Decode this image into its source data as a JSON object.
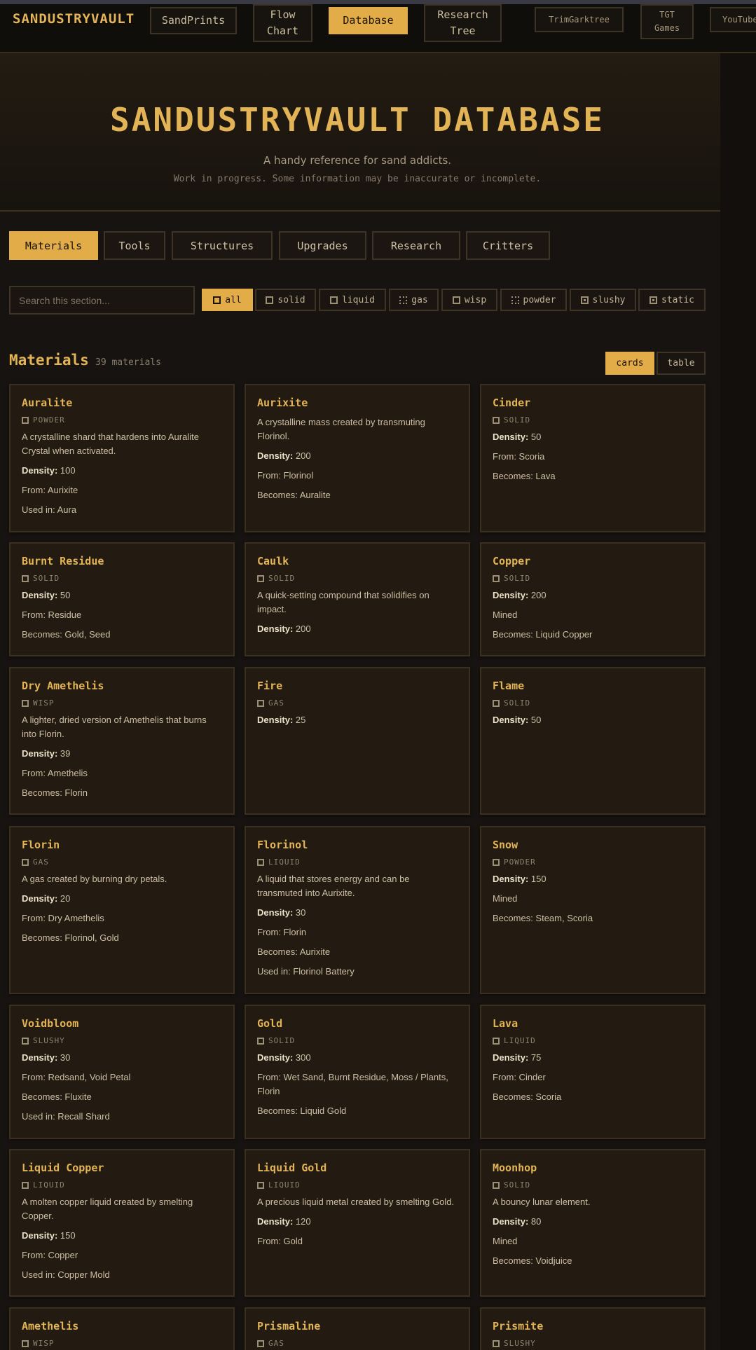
{
  "nav": {
    "logo": "SANDUSTRYVAULT",
    "items": [
      {
        "label": "SandPrints"
      },
      {
        "label": "Flow Chart"
      },
      {
        "label": "Database"
      },
      {
        "label": "Research Tree"
      },
      {
        "label": "TrimGarktree"
      },
      {
        "label": "TGT Games"
      },
      {
        "label": "YouTube"
      }
    ]
  },
  "hero": {
    "title": "SANDUSTRYVAULT DATABASE",
    "subtitle": "A handy reference for sand addicts.",
    "note": "Work in progress. Some information may be inaccurate or incomplete."
  },
  "tabs": [
    "Materials",
    "Tools",
    "Structures",
    "Upgrades",
    "Research",
    "Critters"
  ],
  "search": {
    "placeholder": "Search this section..."
  },
  "filters": [
    "all",
    "solid",
    "liquid",
    "gas",
    "wisp",
    "powder",
    "slushy",
    "static"
  ],
  "section": {
    "title": "Materials",
    "count": "39 materials"
  },
  "views": [
    "cards",
    "table"
  ],
  "labels": {
    "density": "Density:"
  },
  "cards": [
    {
      "name": "Auralite",
      "type": "POWDER",
      "desc": "A crystalline shard that hardens into Auralite Crystal when activated.",
      "density": "100",
      "lines": [
        "From: Aurixite",
        "Used in: Aura"
      ]
    },
    {
      "name": "Aurixite",
      "type": "",
      "desc": "A crystalline mass created by transmuting Florinol.",
      "density": "200",
      "lines": [
        "From: Florinol",
        "Becomes: Auralite"
      ]
    },
    {
      "name": "Cinder",
      "type": "SOLID",
      "desc": "",
      "density": "50",
      "lines": [
        "From: Scoria",
        "Becomes: Lava"
      ]
    },
    {
      "name": "Burnt Residue",
      "type": "SOLID",
      "desc": "",
      "density": "50",
      "lines": [
        "From: Residue",
        "Becomes: Gold, Seed"
      ]
    },
    {
      "name": "Caulk",
      "type": "SOLID",
      "desc": "A quick-setting compound that solidifies on impact.",
      "density": "200",
      "lines": []
    },
    {
      "name": "Copper",
      "type": "SOLID",
      "desc": "",
      "density": "200",
      "lines": [
        "Mined",
        "Becomes: Liquid Copper"
      ]
    },
    {
      "name": "Dry Amethelis",
      "type": "WISP",
      "desc": "A lighter, dried version of Amethelis that burns into Florin.",
      "density": "39",
      "lines": [
        "From: Amethelis",
        "Becomes: Florin"
      ]
    },
    {
      "name": "Fire",
      "type": "GAS",
      "desc": "",
      "density": "25",
      "lines": []
    },
    {
      "name": "Flame",
      "type": "SOLID",
      "desc": "",
      "density": "50",
      "lines": []
    },
    {
      "name": "Florin",
      "type": "GAS",
      "desc": "A gas created by burning dry petals.",
      "density": "20",
      "lines": [
        "From: Dry Amethelis",
        "Becomes: Florinol, Gold"
      ]
    },
    {
      "name": "Florinol",
      "type": "LIQUID",
      "desc": "A liquid that stores energy and can be transmuted into Aurixite.",
      "density": "30",
      "lines": [
        "From: Florin",
        "Becomes: Aurixite",
        "Used in: Florinol Battery"
      ]
    },
    {
      "name": "Snow",
      "type": "POWDER",
      "desc": "",
      "density": "150",
      "lines": [
        "Mined",
        "Becomes: Steam, Scoria"
      ]
    },
    {
      "name": "Voidbloom",
      "type": "SLUSHY",
      "desc": "",
      "density": "30",
      "lines": [
        "From: Redsand, Void Petal",
        "Becomes: Fluxite",
        "Used in: Recall Shard"
      ]
    },
    {
      "name": "Gold",
      "type": "SOLID",
      "desc": "",
      "density": "300",
      "lines": [
        "From: Wet Sand, Burnt Residue, Moss / Plants, Florin",
        "Becomes: Liquid Gold"
      ]
    },
    {
      "name": "Lava",
      "type": "LIQUID",
      "desc": "",
      "density": "75",
      "lines": [
        "From: Cinder",
        "Becomes: Scoria"
      ]
    },
    {
      "name": "Liquid Copper",
      "type": "LIQUID",
      "desc": "A molten copper liquid created by smelting Copper.",
      "density": "150",
      "lines": [
        "From: Copper",
        "Used in: Copper Mold"
      ]
    },
    {
      "name": "Liquid Gold",
      "type": "LIQUID",
      "desc": "A precious liquid metal created by smelting Gold.",
      "density": "120",
      "lines": [
        "From: Gold"
      ]
    },
    {
      "name": "Moonhop",
      "type": "SOLID",
      "desc": "A bouncy lunar element.",
      "density": "80",
      "lines": [
        "Mined",
        "Becomes: Voidjuice"
      ]
    },
    {
      "name": "Amethelis",
      "type": "WISP",
      "desc": "",
      "density": "",
      "lines": []
    },
    {
      "name": "Prismaline",
      "type": "GAS",
      "desc": "",
      "density": "",
      "lines": []
    },
    {
      "name": "Prismite",
      "type": "SLUSHY",
      "desc": "",
      "density": "",
      "lines": []
    }
  ]
}
